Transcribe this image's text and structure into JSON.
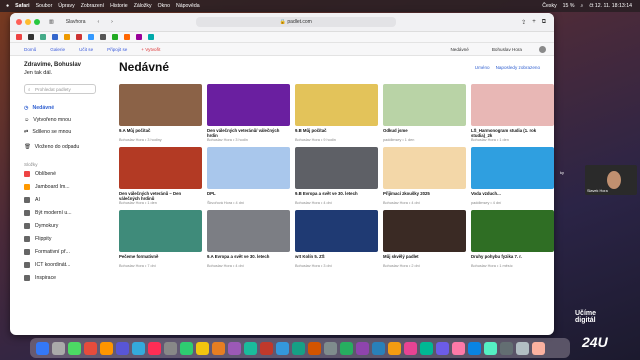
{
  "menubar": {
    "apple": "",
    "app": "Safari",
    "items": [
      "Soubor",
      "Úpravy",
      "Zobrazení",
      "Historie",
      "Záložky",
      "Okno",
      "Nápověda"
    ],
    "right": [
      "Česky",
      "⌁",
      "15 %",
      "☰",
      "☰",
      "⌕",
      "☰",
      "čt 12. 11.  18:13:14"
    ]
  },
  "toolbar": {
    "profile": "Slavhora",
    "url": "padlet.com",
    "lock": "🔒"
  },
  "tabstrip": {
    "links": [
      "Domů",
      "Galerie",
      "Učit se",
      "Připojit se",
      "+ Vytvořit"
    ],
    "right_label": "Nedávné",
    "account": "Bohuslav Hora"
  },
  "sidebar": {
    "greeting": "Zdravíme, Bohuslav",
    "greeting2": "Jen tak dál.",
    "search_placeholder": "Prohledat padlety",
    "nav": [
      "Nedávné",
      "Vytvořeno mnou",
      "Sdíleno se mnou",
      "Vloženo do odpadu"
    ],
    "section": "Složky",
    "boards": [
      "Oblíbené",
      "Jamboard Im...",
      "AI",
      "Být moderní u...",
      "Dymokury",
      "Flippity",
      "Formativní př...",
      "ICT koordinát...",
      "Inspirace"
    ]
  },
  "main": {
    "title": "Nedávné",
    "link1": "Uméno",
    "link2": "Naposledy zobrazeno",
    "cards": [
      {
        "title": "9.A Můj počítač",
        "sub": "Bohuslav Hora • 3 hodiny",
        "color": "#8b6247"
      },
      {
        "title": "Den válečných veteránů/ válečných hrdin",
        "sub": "Bohuslav Hora • 3 hodin",
        "color": "#6a1fa0"
      },
      {
        "title": "9.B Můj počítač",
        "sub": "Bohuslav Hora • 9 hodin",
        "color": "#e3c35a"
      },
      {
        "title": "Odkud jsme",
        "sub": "paddlmsey • 1 den",
        "color": "#b9d3a6"
      },
      {
        "title": "LŠ_Harmonogram studia (1. rok studia)_2k",
        "sub": "Bohuslav Hora • 1 den",
        "color": "#e8b7b5"
      },
      {
        "title": "Den válečných veteránů – Den válečných hrdinů",
        "sub": "Bohuslav Hora • 1 den",
        "color": "#b33a24"
      },
      {
        "title": "DPL",
        "sub": "Škvořová Hora • 4 dní",
        "color": "#a9c7ec"
      },
      {
        "title": "9.B Evropa a svět ve 30. letech",
        "sub": "Bohuslav Hora • 4 dní",
        "color": "#5e6066"
      },
      {
        "title": "Přijímací zkoušky 2025",
        "sub": "Bohuslav Hora • 4 dní",
        "color": "#f3d7a8"
      },
      {
        "title": "Voda vzduch...",
        "sub": "paddlmsey • 4 dní",
        "color": "#2f9fe0"
      },
      {
        "title": "Pečeme formativně",
        "sub": "Bohuslav Hora • 7 dní",
        "color": "#3f8b7a"
      },
      {
        "title": "9.A Evropa a svět ve 30. letech",
        "sub": "Bohuslav Hora • 4 dní",
        "color": "#7c7e84"
      },
      {
        "title": "w!t Kolín 5. ZŠ",
        "sub": "Bohuslav Hora • 3 dní",
        "color": "#1f3a73"
      },
      {
        "title": "Můj skvělý padlet",
        "sub": "Bohuslav Hora • 2 dní",
        "color": "#3a2a24"
      },
      {
        "title": "Druhy pohybu fyzika 7. r.",
        "sub": "Bohuslav Hora • 1 měsíc",
        "color": "#2f6e24"
      }
    ]
  },
  "overlay": {
    "speaker": "Slavek Hora",
    "logo_line1": "Učíme",
    "logo_line2": "digitál",
    "logo_24u": "24U",
    "desk_text": "ky"
  },
  "colors": {
    "accent": "#2f5fd0"
  }
}
